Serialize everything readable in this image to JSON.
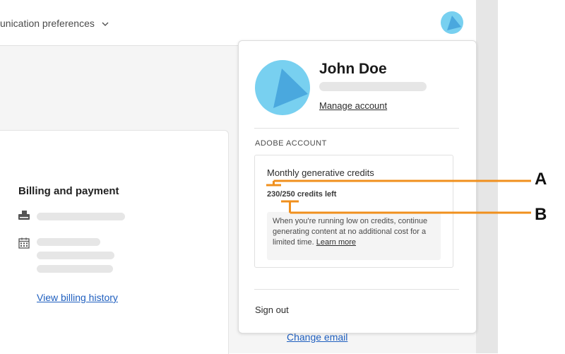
{
  "header": {
    "nav_partial_label": "unication preferences",
    "chevron_icon": "chevron-down-icon",
    "avatar_icon": "user-avatar-icon"
  },
  "billing_card": {
    "title": "Billing and payment",
    "icons": [
      "credit-card-icon",
      "calendar-icon"
    ],
    "link": "View billing history"
  },
  "background_link": "Change email",
  "popover": {
    "user_name": "John Doe",
    "manage_link": "Manage account",
    "section_label": "ADOBE ACCOUNT",
    "credits": {
      "title": "Monthly generative credits",
      "count": "230/250 credits left",
      "info_text": "When you're running low on credits, continue generating content at no additional cost for a limited time.",
      "learn_more": "Learn more"
    },
    "sign_out": "Sign out"
  },
  "callouts": {
    "a": "A",
    "b": "B",
    "color": "#f0901e"
  },
  "colors": {
    "avatar": "#78d0f0",
    "avatar_shape": "#4aa8de",
    "link": "#1f5fbf",
    "skeleton": "#e6e6e6"
  }
}
